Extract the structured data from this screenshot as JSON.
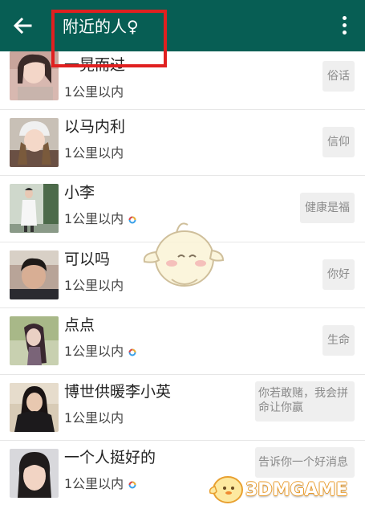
{
  "app_bar": {
    "title": "附近的人♀",
    "background": "#075e54",
    "highlight_color": "#e02020"
  },
  "people": [
    {
      "name": "一晃而过",
      "distance": "1公里以内",
      "status": "俗话",
      "online": false
    },
    {
      "name": "以马内利",
      "distance": "1公里以内",
      "status": "信仰",
      "online": false
    },
    {
      "name": "小李",
      "distance": "1公里以内",
      "status": "健康是福",
      "online": true
    },
    {
      "name": "可以吗",
      "distance": "1公里以内",
      "status": "你好",
      "online": false
    },
    {
      "name": "点点",
      "distance": "1公里以内",
      "status": "生命",
      "online": true
    },
    {
      "name": "博世供暖李小英",
      "distance": "1公里以内",
      "status": "你若敢赌，我会拼命让你赢",
      "online": false
    },
    {
      "name": "一个人挺好的",
      "distance": "1公里以内",
      "status": "告诉你一个好消息",
      "online": true
    }
  ],
  "watermark": {
    "text": "3DMGAME"
  }
}
